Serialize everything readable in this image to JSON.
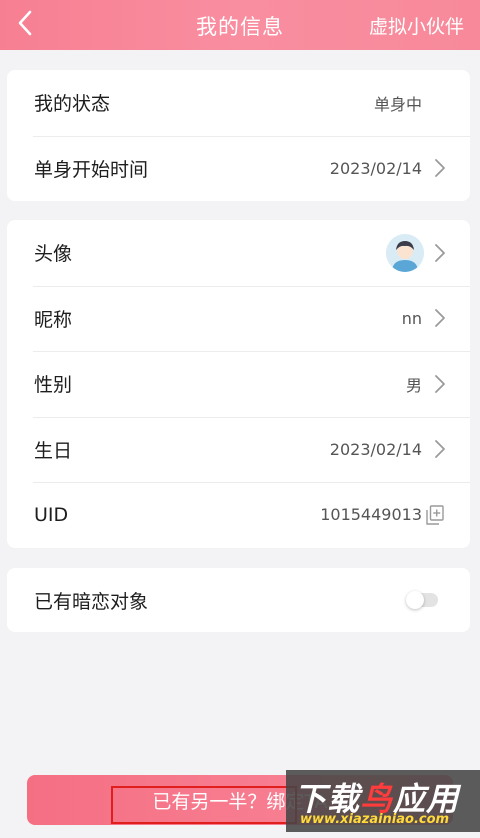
{
  "header": {
    "title": "我的信息",
    "action": "虚拟小伙伴"
  },
  "status_card": {
    "rows": [
      {
        "label": "我的状态",
        "value": "单身中"
      },
      {
        "label": "单身开始时间",
        "value": "2023/02/14"
      }
    ]
  },
  "profile_card": {
    "avatar_label": "头像",
    "nickname": {
      "label": "昵称",
      "value": "nn"
    },
    "gender": {
      "label": "性别",
      "value": "男"
    },
    "birthday": {
      "label": "生日",
      "value": "2023/02/14"
    },
    "uid": {
      "label": "UID",
      "value": "1015449013"
    }
  },
  "crush_card": {
    "label": "已有暗恋对象",
    "toggle_on": false
  },
  "bind_button": {
    "label": "已有另一半？绑定TA"
  },
  "watermark": {
    "logo": "下载鸟应用",
    "url": "www.xiazainiao.com"
  },
  "colors": {
    "accent": "#f77f92",
    "button": "#f56f83"
  },
  "icons": [
    "back-arrow-icon",
    "chevron-right-icon",
    "avatar-icon",
    "copy-icon",
    "toggle-switch"
  ]
}
